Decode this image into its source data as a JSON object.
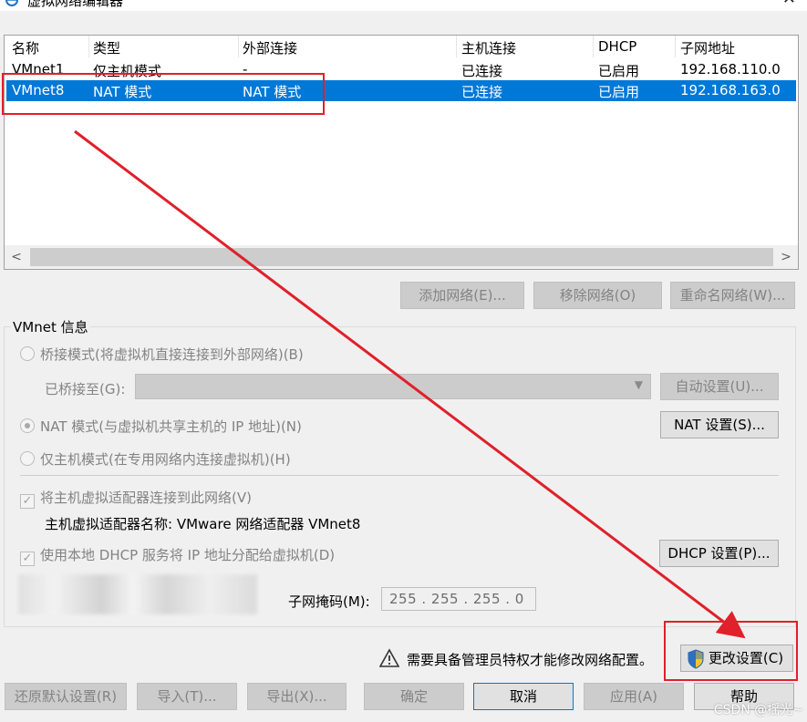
{
  "window": {
    "title": "虚拟网络编辑器",
    "close": "✕"
  },
  "listview": {
    "columns": [
      "名称",
      "类型",
      "外部连接",
      "主机连接",
      "DHCP",
      "子网地址"
    ],
    "rows": [
      [
        "VMnet1",
        "仅主机模式",
        "-",
        "已连接",
        "已启用",
        "192.168.110.0"
      ],
      [
        "VMnet8",
        "NAT 模式",
        "NAT 模式",
        "已连接",
        "已启用",
        "192.168.163.0"
      ]
    ],
    "selected_row": 1
  },
  "list_buttons": {
    "add": "添加网络(E)...",
    "remove": "移除网络(O)",
    "rename": "重命名网络(W)..."
  },
  "vmnet_info": {
    "label": "VMnet 信息",
    "bridged_label": "桥接模式(将虚拟机直接连接到外部网络)(B)",
    "bridged_to_label": "已桥接至(G):",
    "auto_button": "自动设置(U)...",
    "nat_label": "NAT 模式(与虚拟机共享主机的 IP 地址)(N)",
    "nat_button": "NAT 设置(S)...",
    "hostonly_label": "仅主机模式(在专用网络内连接虚拟机)(H)",
    "connect_adapter_label": "将主机虚拟适配器连接到此网络(V)",
    "adapter_name_label": "主机虚拟适配器名称: VMware 网络适配器 VMnet8",
    "dhcp_label": "使用本地 DHCP 服务将 IP 地址分配给虚拟机(D)",
    "dhcp_button": "DHCP 设置(P)...",
    "subnet_mask_label": "子网掩码(M):",
    "subnet_mask_value": "255 . 255 . 255 .  0"
  },
  "warning": {
    "text": "需要具备管理员特权才能修改网络配置。",
    "change_button": "更改设置(C)"
  },
  "bottom_buttons": {
    "restore": "还原默认设置(R)",
    "import": "导入(T)...",
    "export": "导出(X)...",
    "ok": "确定",
    "cancel": "取消",
    "apply": "应用(A)",
    "help": "帮助"
  },
  "watermark": "CSDN @摇光~",
  "colors": {
    "selection": "#0078d7",
    "annotation": "#e0202a"
  },
  "checkbox_states": {
    "connect_adapter": true,
    "dhcp": true
  },
  "radio_selected": "nat"
}
